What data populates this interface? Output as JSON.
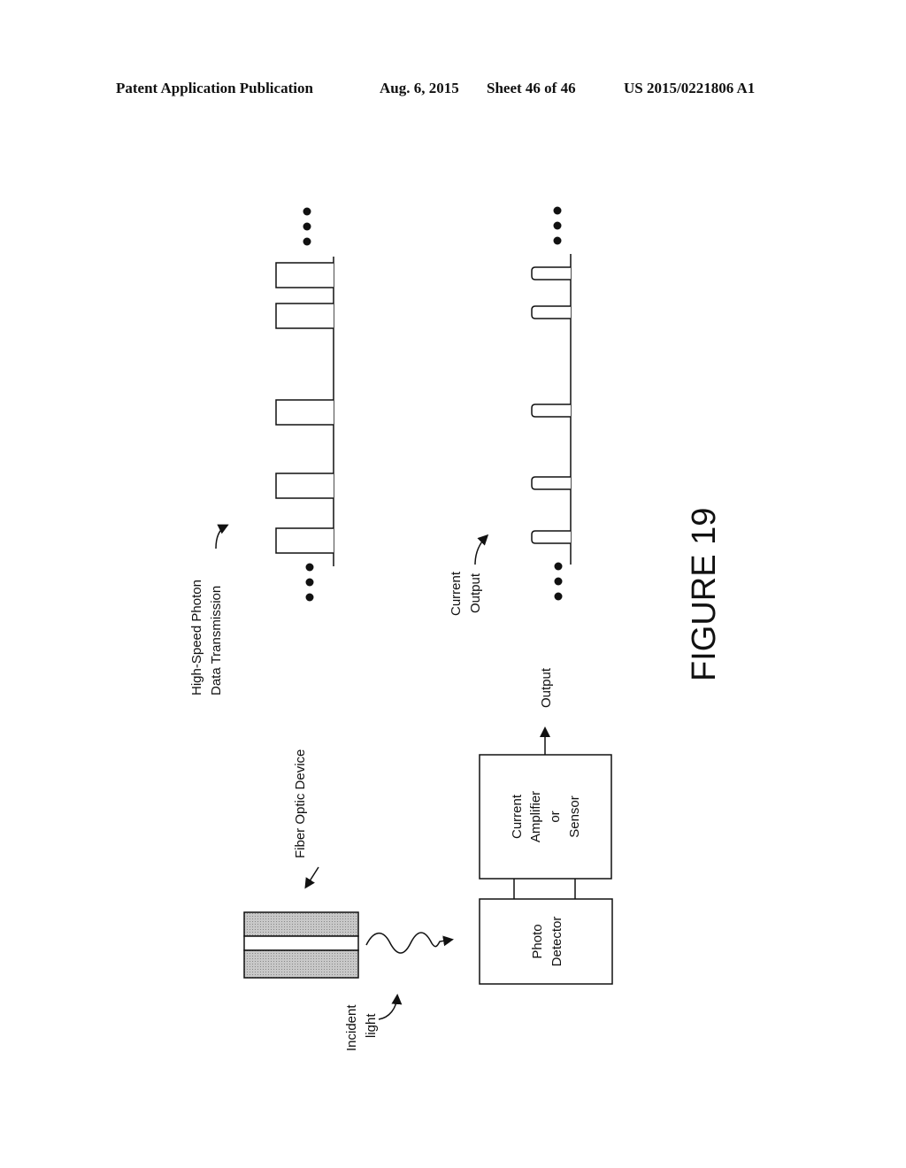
{
  "header": {
    "publication": "Patent Application Publication",
    "date": "Aug. 6, 2015",
    "sheet": "Sheet 46 of 46",
    "number": "US 2015/0221806 A1"
  },
  "figure": {
    "title": "FIGURE 19",
    "labels": {
      "fiber_optic_device": "Fiber Optic Device",
      "incident_light_1": "Incident",
      "incident_light_2": "light",
      "photo_detector_1": "Photo",
      "photo_detector_2": "Detector",
      "amplifier_1": "Current",
      "amplifier_2": "Amplifier",
      "amplifier_3": "or",
      "amplifier_4": "Sensor",
      "output": "Output",
      "transmission_1": "High-Speed Photon",
      "transmission_2": "Data Transmission",
      "current_output_1": "Current",
      "current_output_2": "Output"
    },
    "pulse_trains": [
      {
        "name": "High-Speed Photon Data Transmission",
        "pulse_count": 5,
        "pulse_type": "square"
      },
      {
        "name": "Current Output",
        "pulse_count": 5,
        "pulse_type": "narrow-rounded"
      }
    ]
  },
  "colors": {
    "ink": "#111111",
    "fiber_cladding": "#b8b8b8"
  }
}
